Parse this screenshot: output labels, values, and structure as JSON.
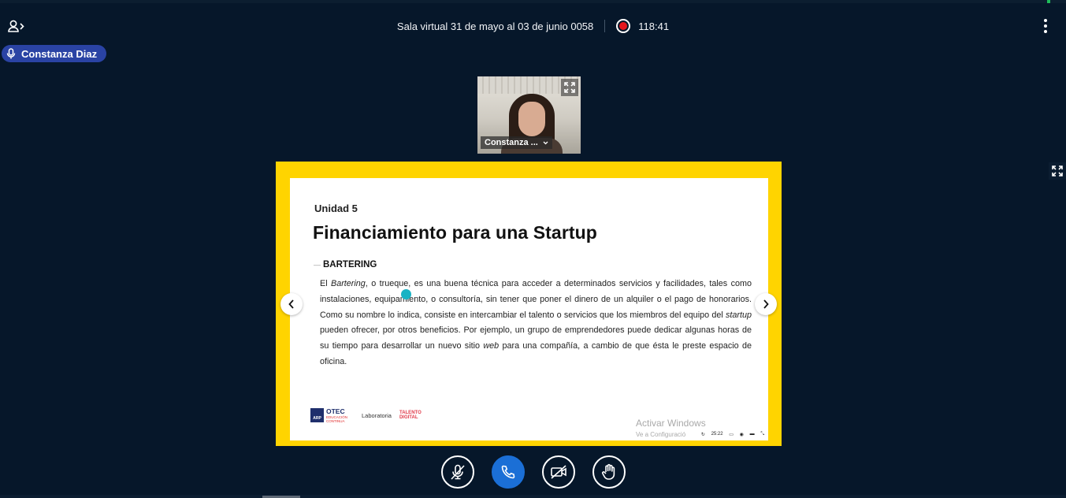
{
  "window": {
    "title": "Sala virtual 31 de mayo al 03 de junio 0058",
    "recording_time": "118:41",
    "accent_color": "#1fbd5a",
    "recording_color": "#e5161d"
  },
  "header": {
    "userlist_icon": "user-list-toggle-icon",
    "more_icon": "more-vertical-icon"
  },
  "talking_indicator": {
    "name": "Constanza Diaz",
    "icon": "microphone-icon",
    "color": "#2a43a4"
  },
  "webcam": {
    "participant_name": "Constanza ...",
    "expand_icon": "fullscreen-icon"
  },
  "presentation": {
    "frame_color": "#ffd400",
    "slide": {
      "unit": "Unidad 5",
      "heading": "Financiamiento para una Startup",
      "subheading": "BARTERING",
      "body": {
        "p1": "El ",
        "p1_em": "Bartering",
        "p2": ", o trueque, es una buena técnica para acceder a determinados servicios y facilidades, tales como instalaciones, equipamiento, o consultoría, sin tener que poner el dinero de un alquiler o el pago de honorarios. Como su nombre lo indica, consiste en intercambiar el talento o servicios que los miembros del equipo del ",
        "p2_em": "startup",
        "p3": " pueden ofrecer, por otros beneficios. Por ejemplo, un grupo de emprendedores puede dedicar algunas horas de su tiempo para desarrollar un nuevo sitio ",
        "p3_em": "web",
        "p4": " para una compañía, a cambio de que ésta le preste espacio de oficina."
      },
      "logos": {
        "arp_box": "ARP",
        "otec": "OTEC",
        "otec_sub1": "EDUCACIÓN",
        "otec_sub2": "CONTINUA",
        "laboratoria": "Laboratoria",
        "talento1": "TALENTO",
        "talento2": "DIGITAL"
      },
      "watermark_line1": "Activar Windows",
      "watermark_line2": "Ve a Configuració",
      "mini_toolbar_time": "25:22"
    },
    "prev_icon": "chevron-left-icon",
    "next_icon": "chevron-right-icon",
    "fullscreen_icon": "fullscreen-icon"
  },
  "controls": {
    "mute": "microphone-muted-icon",
    "hangup": "phone-icon",
    "camera": "camera-off-icon",
    "raise_hand": "raise-hand-icon",
    "call_color": "#1b6fd6"
  }
}
